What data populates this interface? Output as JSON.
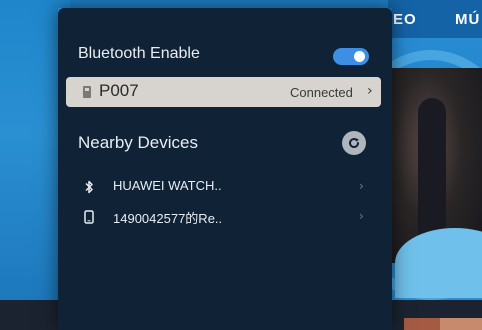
{
  "background": {
    "nav_labels": [
      "EO",
      "MÚ"
    ],
    "accent_color": "#1e7fc6"
  },
  "bluetooth": {
    "enable_label": "Bluetooth Enable",
    "enabled": true,
    "toggle_color": "#3d8fe6"
  },
  "connected_device": {
    "name": "P007",
    "status": "Connected",
    "chevron": "›",
    "icon": "device-phone-icon"
  },
  "nearby": {
    "title": "Nearby Devices",
    "refresh_icon": "refresh-icon",
    "devices": [
      {
        "name": "HUAWEI WATCH..",
        "icon": "bluetooth-icon",
        "chevron": "›"
      },
      {
        "name": "1490042577的Re..",
        "icon": "phone-outline-icon",
        "chevron": "›"
      }
    ]
  }
}
